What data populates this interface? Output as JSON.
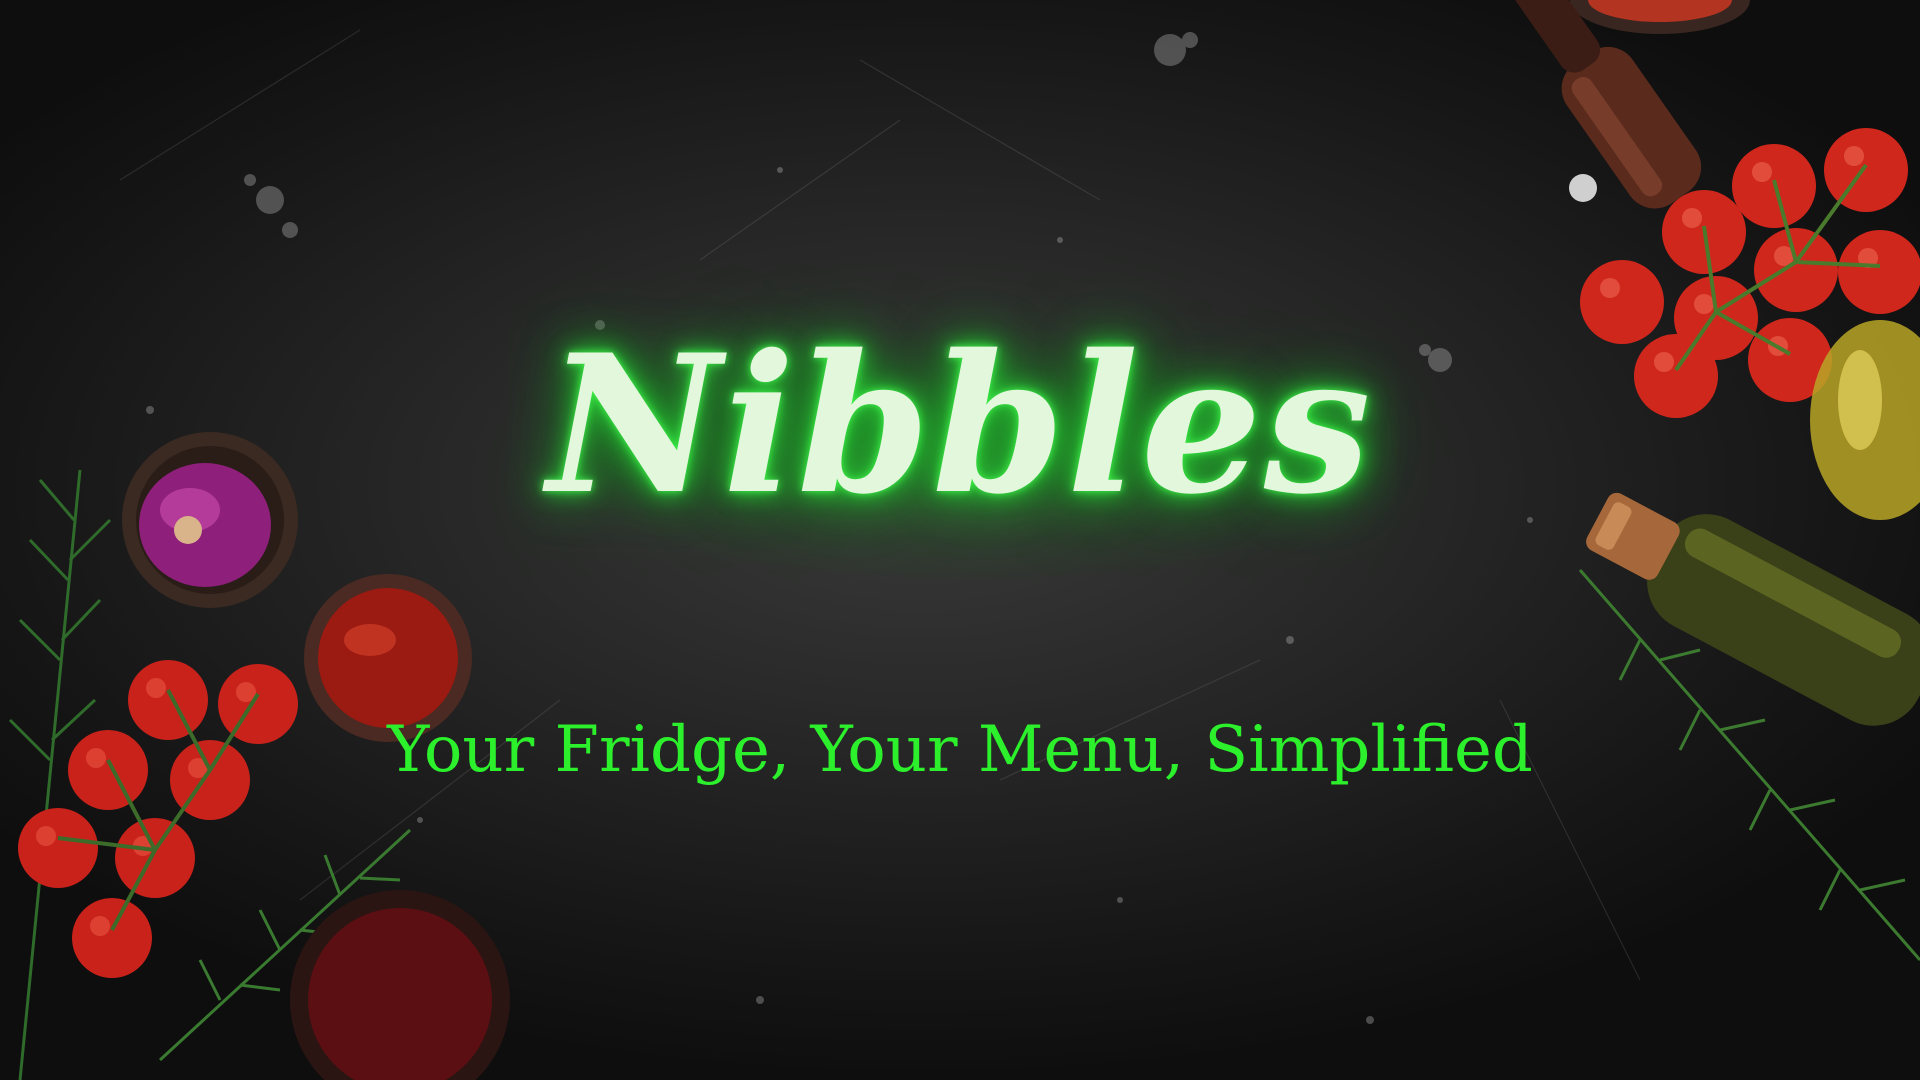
{
  "hero": {
    "brand": "Nibbles",
    "tagline": "Your Fridge, Your Menu, Simplified"
  },
  "colors": {
    "background": "#1a1a1a",
    "brand_text": "#e2f7dc",
    "brand_glow": "#2ed63a",
    "tagline": "#2bf02b"
  },
  "decorations": {
    "left": [
      "red-onion-bowl-icon",
      "tomato-sauce-bowl-icon",
      "cherry-tomatoes-icon",
      "rosemary-icon",
      "sauce-bowl-icon"
    ],
    "right": [
      "spice-bowl-icon",
      "pepper-grinder-icon",
      "cherry-tomatoes-icon",
      "olive-oil-bottle-icon",
      "rosemary-icon"
    ]
  }
}
